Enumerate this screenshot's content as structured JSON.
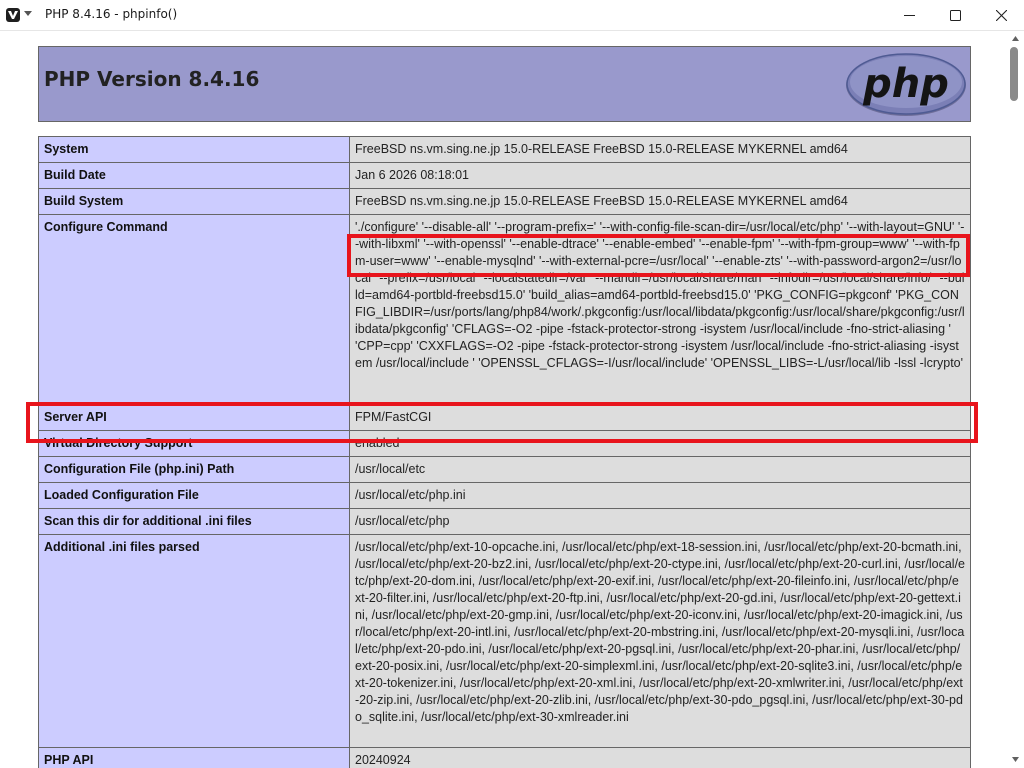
{
  "window": {
    "title": "PHP 8.4.16 - phpinfo()",
    "controls": [
      "minimize-icon",
      "maximize-icon",
      "close-icon"
    ]
  },
  "page": {
    "title": "PHP Version 8.4.16",
    "logo_text": "php"
  },
  "rows": [
    {
      "key": "System",
      "value": "FreeBSD ns.vm.sing.ne.jp 15.0-RELEASE FreeBSD 15.0-RELEASE MYKERNEL amd64"
    },
    {
      "key": "Build Date",
      "value": "Jan 6 2026 08:18:01"
    },
    {
      "key": "Build System",
      "value": "FreeBSD ns.vm.sing.ne.jp 15.0-RELEASE FreeBSD 15.0-RELEASE MYKERNEL amd64"
    },
    {
      "key": "Configure Command",
      "value": "'./configure' '--disable-all' '--program-prefix=' '--with-config-file-scan-dir=/usr/local/etc/php' '--with-layout=GNU' '--with-libxml' '--with-openssl' '--enable-dtrace' '--enable-embed' '--enable-fpm' '--with-fpm-group=www' '--with-fpm-user=www' '--enable-mysqlnd' '--with-external-pcre=/usr/local' '--enable-zts' '--with-password-argon2=/usr/local' '--prefix=/usr/local' '--localstatedir=/var' '--mandir=/usr/local/share/man' '--infodir=/usr/local/share/info/' '--build=amd64-portbld-freebsd15.0' 'build_alias=amd64-portbld-freebsd15.0' 'PKG_CONFIG=pkgconf' 'PKG_CONFIG_LIBDIR=/usr/ports/lang/php84/work/.pkgconfig:/usr/local/libdata/pkgconfig:/usr/local/share/pkgconfig:/usr/libdata/pkgconfig' 'CFLAGS=-O2 -pipe -fstack-protector-strong -isystem /usr/local/include -fno-strict-aliasing ' 'CPP=cpp' 'CXXFLAGS=-O2 -pipe -fstack-protector-strong -isystem /usr/local/include -fno-strict-aliasing -isystem /usr/local/include ' 'OPENSSL_CFLAGS=-I/usr/local/include' 'OPENSSL_LIBS=-L/usr/local/lib -lssl -lcrypto'"
    },
    {
      "key": "Server API",
      "value": "FPM/FastCGI"
    },
    {
      "key": "Virtual Directory Support",
      "value": "enabled"
    },
    {
      "key": "Configuration File (php.ini) Path",
      "value": "/usr/local/etc"
    },
    {
      "key": "Loaded Configuration File",
      "value": "/usr/local/etc/php.ini"
    },
    {
      "key": "Scan this dir for additional .ini files",
      "value": "/usr/local/etc/php"
    },
    {
      "key": "Additional .ini files parsed",
      "value": "/usr/local/etc/php/ext-10-opcache.ini, /usr/local/etc/php/ext-18-session.ini, /usr/local/etc/php/ext-20-bcmath.ini, /usr/local/etc/php/ext-20-bz2.ini, /usr/local/etc/php/ext-20-ctype.ini, /usr/local/etc/php/ext-20-curl.ini, /usr/local/etc/php/ext-20-dom.ini, /usr/local/etc/php/ext-20-exif.ini, /usr/local/etc/php/ext-20-fileinfo.ini, /usr/local/etc/php/ext-20-filter.ini, /usr/local/etc/php/ext-20-ftp.ini, /usr/local/etc/php/ext-20-gd.ini, /usr/local/etc/php/ext-20-gettext.ini, /usr/local/etc/php/ext-20-gmp.ini, /usr/local/etc/php/ext-20-iconv.ini, /usr/local/etc/php/ext-20-imagick.ini, /usr/local/etc/php/ext-20-intl.ini, /usr/local/etc/php/ext-20-mbstring.ini, /usr/local/etc/php/ext-20-mysqli.ini, /usr/local/etc/php/ext-20-pdo.ini, /usr/local/etc/php/ext-20-pgsql.ini, /usr/local/etc/php/ext-20-phar.ini, /usr/local/etc/php/ext-20-posix.ini, /usr/local/etc/php/ext-20-simplexml.ini, /usr/local/etc/php/ext-20-sqlite3.ini, /usr/local/etc/php/ext-20-tokenizer.ini, /usr/local/etc/php/ext-20-xml.ini, /usr/local/etc/php/ext-20-xmlwriter.ini, /usr/local/etc/php/ext-20-zip.ini, /usr/local/etc/php/ext-20-zlib.ini, /usr/local/etc/php/ext-30-pdo_pgsql.ini, /usr/local/etc/php/ext-30-pdo_sqlite.ini, /usr/local/etc/php/ext-30-xmlreader.ini"
    },
    {
      "key": "PHP API",
      "value": "20240924"
    }
  ],
  "colors": {
    "header_bg": "#9999cc",
    "key_bg": "#ccccff",
    "value_bg": "#dddddd",
    "highlight": "#e8141c"
  }
}
